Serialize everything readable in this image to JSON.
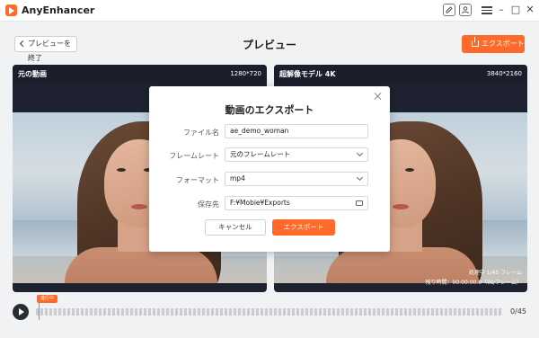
{
  "app": {
    "title": "AnyEnhancer"
  },
  "window_controls": {
    "minimize": "–",
    "maximize": "□",
    "close": "✕"
  },
  "header": {
    "back_label": "プレビューを終了",
    "title": "プレビュー",
    "export_label": "エクスポート"
  },
  "panels": {
    "left": {
      "title": "元の動画",
      "resolution": "1280*720"
    },
    "right": {
      "title": "超解像モデル 4K",
      "resolution": "3840*2160",
      "progress_text": "処理中 1/45 フレーム",
      "remaining_text": "残り時間：00:00:00.0（0s/フレーム）"
    }
  },
  "timeline": {
    "status_tag": "進行中",
    "counter": "0/45"
  },
  "dialog": {
    "title": "動画のエクスポート",
    "fields": {
      "filename": {
        "label": "ファイル名",
        "value": "ae_demo_woman"
      },
      "framerate": {
        "label": "フレームレート",
        "value": "元のフレームレート"
      },
      "format": {
        "label": "フォーマット",
        "value": "mp4"
      },
      "save_to": {
        "label": "保存先",
        "value": "F:¥Mobie¥Exports"
      }
    },
    "cancel_label": "キャンセル",
    "export_label": "エクスポート"
  },
  "colors": {
    "accent": "#ff6a2b",
    "panel_bg": "#1e2230"
  }
}
